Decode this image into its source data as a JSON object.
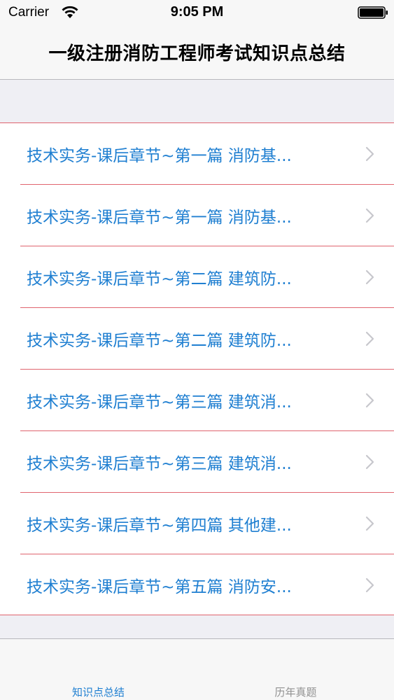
{
  "status_bar": {
    "carrier": "Carrier",
    "time": "9:05 PM"
  },
  "nav": {
    "title": "一级注册消防工程师考试知识点总结"
  },
  "list": {
    "items": [
      {
        "label": "技术实务-课后章节~第一篇 消防基..."
      },
      {
        "label": "技术实务-课后章节~第一篇 消防基..."
      },
      {
        "label": "技术实务-课后章节~第二篇 建筑防..."
      },
      {
        "label": "技术实务-课后章节~第二篇 建筑防..."
      },
      {
        "label": "技术实务-课后章节~第三篇 建筑消..."
      },
      {
        "label": "技术实务-课后章节~第三篇 建筑消..."
      },
      {
        "label": "技术实务-课后章节~第四篇 其他建..."
      },
      {
        "label": "技术实务-课后章节~第五篇 消防安..."
      }
    ]
  },
  "tabbar": {
    "tabs": [
      {
        "label": "知识点总结",
        "active": true
      },
      {
        "label": "历年真题",
        "active": false
      }
    ]
  },
  "colors": {
    "accent": "#1f7fd1",
    "separator": "#e0646e",
    "chevron": "#c7c7cc",
    "inactive_tab": "#929292"
  },
  "icons": {
    "wifi": "wifi-icon",
    "battery": "battery-icon",
    "chevron": "chevron-right-icon"
  }
}
